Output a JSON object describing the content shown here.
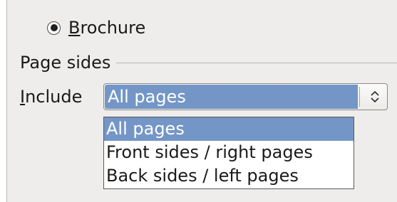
{
  "brochure": {
    "label_first": "B",
    "label_rest": "rochure",
    "selected": true
  },
  "page_sides": {
    "section_label": "Page sides",
    "include_first": "I",
    "include_rest": "nclude",
    "current_value": "All pages",
    "options": [
      {
        "label": "All pages",
        "selected": true
      },
      {
        "label": "Front sides / right pages",
        "selected": false
      },
      {
        "label": "Back sides / left pages",
        "selected": false
      }
    ]
  },
  "colors": {
    "selection": "#7396c7",
    "panel": "#eeedeb"
  },
  "icons": {
    "combo": "updown-arrows-icon",
    "radio": "radio-selected-icon"
  }
}
